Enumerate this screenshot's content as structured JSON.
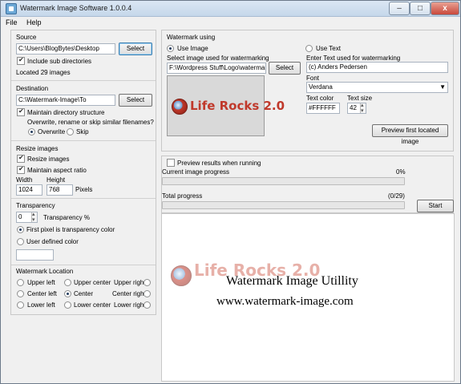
{
  "window": {
    "title": "Watermark Image Software 1.0.0.4",
    "min_glyph": "–",
    "max_glyph": "□",
    "close_glyph": "x"
  },
  "menu": {
    "file": "File",
    "help": "Help"
  },
  "source": {
    "title": "Source",
    "path": "C:\\Users\\BlogBytes\\Desktop",
    "select_label": "Select",
    "include_sub_label": "Include sub directories",
    "include_sub_checked": true,
    "count_text": "Located 29 images"
  },
  "destination": {
    "title": "Destination",
    "path": "C:\\Watermark-Image\\To",
    "select_label": "Select",
    "maintain_label": "Maintain directory structure",
    "maintain_checked": true,
    "question": "Overwrite, rename or skip similar filenames?",
    "overwrite_label": "Overwrite",
    "skip_label": "Skip",
    "selected_option": "Overwrite"
  },
  "resize": {
    "title": "Resize images",
    "resize_label": "Resize images",
    "resize_checked": true,
    "aspect_label": "Maintain aspect ratio",
    "aspect_checked": true,
    "width_label": "Width",
    "height_label": "Height",
    "width_value": "1024",
    "height_value": "768",
    "unit_label": "Pixels"
  },
  "transparency": {
    "title": "Transparency",
    "value": "0",
    "percent_label": "Transparency %",
    "first_pixel_label": "First pixel is transparency color",
    "user_defined_label": "User defined color",
    "selected_option": "First pixel is transparency color",
    "color_value": ""
  },
  "location": {
    "title": "Watermark Location",
    "options": [
      "Upper left",
      "Upper center",
      "Upper right",
      "Center left",
      "Center",
      "Center right",
      "Lower left",
      "Lower center",
      "Lower right"
    ],
    "selected": "Center"
  },
  "watermark": {
    "title": "Watermark using",
    "use_image_label": "Use Image",
    "use_text_label": "Use Text",
    "selected_mode": "Use Image",
    "image_label": "Select image used for watermarking",
    "image_path": "F:\\Wordpress Stuff\\Logo\\watermark.gif",
    "image_select_label": "Select",
    "text_label": "Enter Text used for watermarking",
    "text_value": "(c) Anders Pedersen",
    "font_label": "Font",
    "font_value": "Verdana",
    "text_color_label": "Text color",
    "text_color_value": "#FFFFFF",
    "text_size_label": "Text size",
    "text_size_value": "42",
    "preview_button_label": "Preview first located image",
    "logo_text": "Life Rocks 2.0"
  },
  "progress": {
    "preview_label": "Preview results when running",
    "preview_checked": false,
    "current_label": "Current image progress",
    "current_value": "0%",
    "current_fraction": 0,
    "total_label": "Total progress",
    "total_value": "(0/29)",
    "total_fraction": 0,
    "start_label": "Start"
  },
  "preview": {
    "logo_text": "Life Rocks 2.0",
    "line1": "Watermark Image Utillity",
    "line2": "www.watermark-image.com"
  },
  "colors": {
    "accent": "#3c7fb1",
    "progress_green": "#06b025",
    "logo_red": "#c0392b"
  }
}
